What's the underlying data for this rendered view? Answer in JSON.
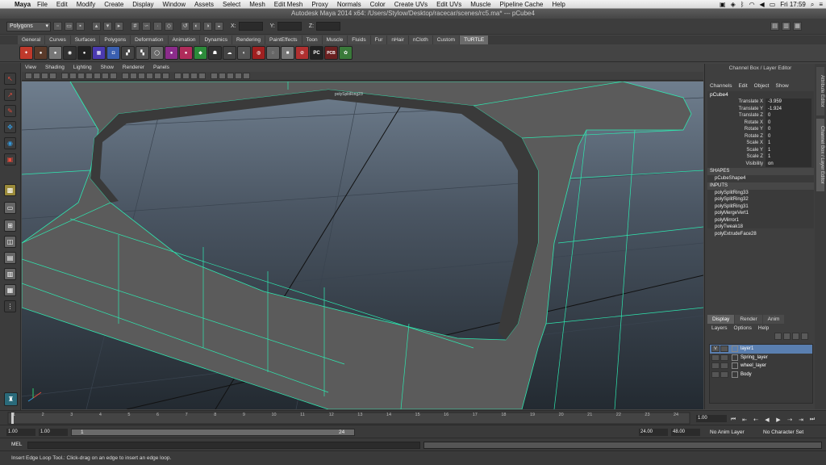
{
  "menubar": {
    "app": "Maya",
    "items": [
      "File",
      "Edit",
      "Modify",
      "Create",
      "Display",
      "Window",
      "Assets",
      "Select",
      "Mesh",
      "Edit Mesh",
      "Proxy",
      "Normals",
      "Color",
      "Create UVs",
      "Edit UVs",
      "Muscle",
      "Pipeline Cache",
      "Help"
    ],
    "clock": "Fri 17:59"
  },
  "window_title": "Autodesk Maya 2014 x64: /Users/Stylow/Desktop/racecar/scenes/rc5.ma*   ---   pCube4",
  "status_line": {
    "mode": "Polygons",
    "x_label": "X:",
    "y_label": "Y:",
    "z_label": "Z:"
  },
  "shelf": {
    "tabs": [
      "General",
      "Curves",
      "Surfaces",
      "Polygons",
      "Deformation",
      "Animation",
      "Dynamics",
      "Rendering",
      "PaintEffects",
      "Toon",
      "Muscle",
      "Fluids",
      "Fur",
      "nHair",
      "nCloth",
      "Custom",
      "TURTLE"
    ],
    "active_tab": "TURTLE",
    "icon_labels": {
      "pc": "PC",
      "pcb": "PCB"
    }
  },
  "panel_menu": [
    "View",
    "Shading",
    "Lighting",
    "Show",
    "Renderer",
    "Panels"
  ],
  "viewport": {
    "label": "polySplitRing23"
  },
  "channel_box": {
    "title": "Channel Box / Layer Editor",
    "menu": [
      "Channels",
      "Edit",
      "Object",
      "Show"
    ],
    "object": "pCube4",
    "attributes": [
      {
        "name": "Translate X",
        "value": "-3.959"
      },
      {
        "name": "Translate Y",
        "value": "-1.924"
      },
      {
        "name": "Translate Z",
        "value": "0"
      },
      {
        "name": "Rotate X",
        "value": "0"
      },
      {
        "name": "Rotate Y",
        "value": "0"
      },
      {
        "name": "Rotate Z",
        "value": "0"
      },
      {
        "name": "Scale X",
        "value": "1"
      },
      {
        "name": "Scale Y",
        "value": "1"
      },
      {
        "name": "Scale Z",
        "value": "1"
      },
      {
        "name": "Visibility",
        "value": "on"
      }
    ],
    "shapes_header": "SHAPES",
    "shapes": [
      "pCubeShape4"
    ],
    "inputs_header": "INPUTS",
    "inputs": [
      "polySplitRing33",
      "polySplitRing32",
      "polySplitRing31",
      "polyMergeVert1",
      "polyMirror1",
      "polyTweak18",
      "polyExtrudeFace28"
    ]
  },
  "layer_editor": {
    "tabs": [
      "Display",
      "Render",
      "Anim"
    ],
    "active_tab": "Display",
    "menu": [
      "Layers",
      "Options",
      "Help"
    ],
    "layers": [
      {
        "name": "layer1",
        "visible": "V",
        "selected": true
      },
      {
        "name": "Spring_layer",
        "visible": "",
        "selected": false
      },
      {
        "name": "wheel_layer",
        "visible": "",
        "selected": false
      },
      {
        "name": "Body",
        "visible": "",
        "selected": false
      }
    ]
  },
  "side_tabs": [
    "Attribute Editor",
    "Channel Box / Layer Editor"
  ],
  "time_slider": {
    "ticks": [
      "1",
      "2",
      "3",
      "4",
      "5",
      "6",
      "7",
      "8",
      "9",
      "10",
      "11",
      "12",
      "13",
      "14",
      "15",
      "16",
      "17",
      "18",
      "19",
      "20",
      "21",
      "22",
      "23",
      "24"
    ],
    "current_frame": "1.00"
  },
  "range_slider": {
    "start_time": "1.00",
    "playback_start": "1.00",
    "range_left": "1",
    "range_right": "24",
    "playback_end": "24.00",
    "end_time": "48.00",
    "anim_layer": "No Anim Layer",
    "character_set": "No Character Set"
  },
  "command_line": {
    "label": "MEL"
  },
  "help_line": {
    "text": "Insert Edge Loop Tool.: Click-drag on an edge to insert an edge loop."
  },
  "colors": {
    "wireframe": "#2ee8b0",
    "selection": "#5a7fb0"
  }
}
